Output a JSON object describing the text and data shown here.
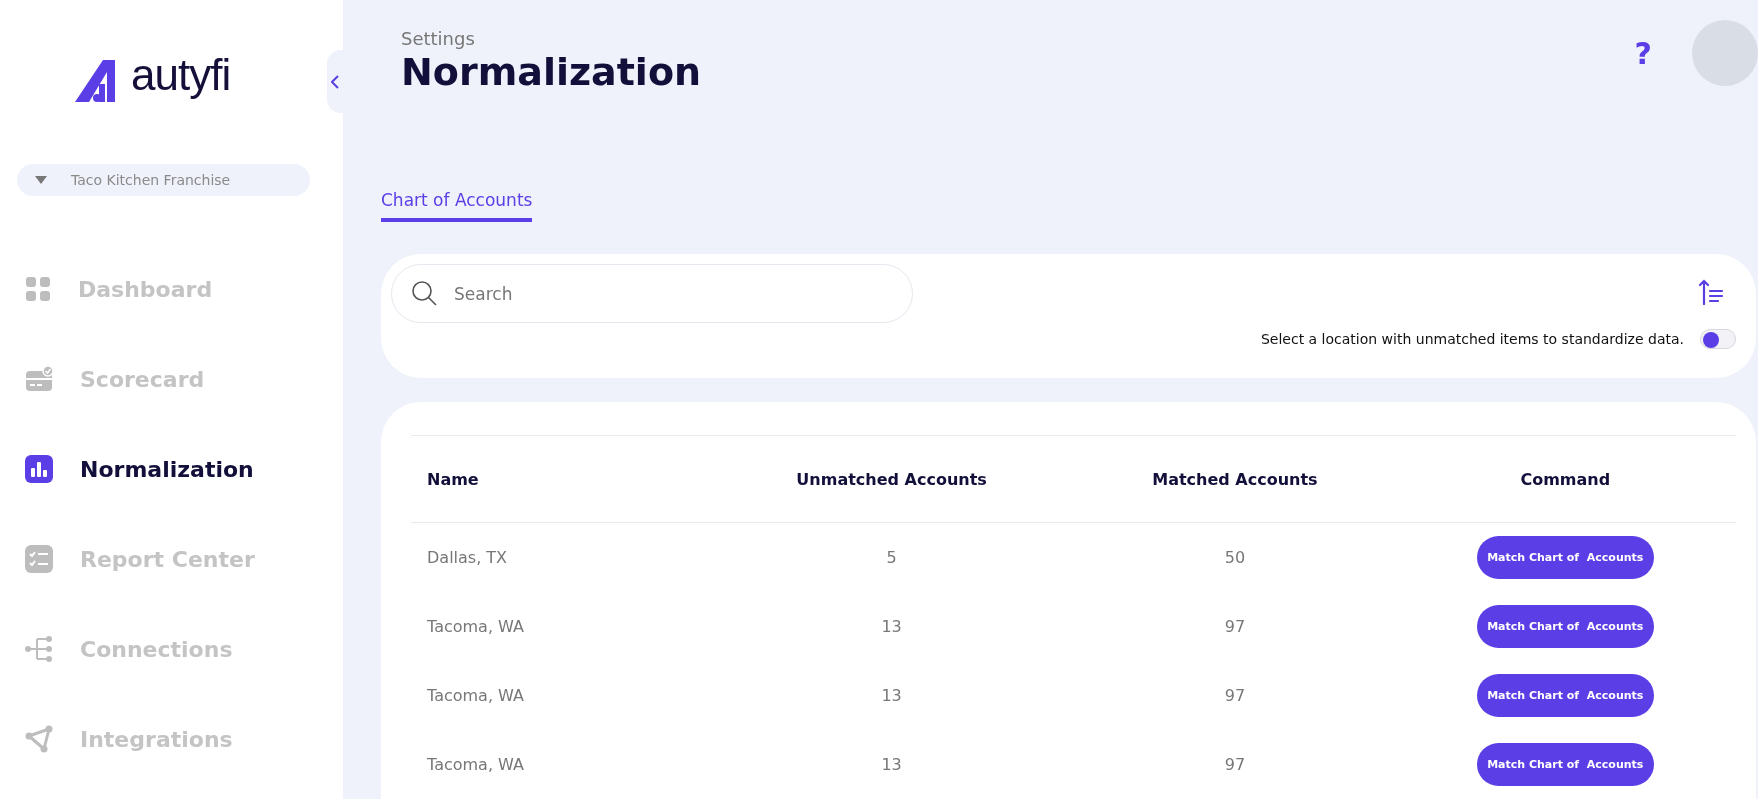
{
  "sidebar": {
    "logo": "autyfi",
    "workspace": "Taco Kitchen Franchise",
    "items": [
      {
        "kind": "dashboard",
        "label": "Dashboard",
        "selected": false
      },
      {
        "kind": "scorecard",
        "label": "Scorecard",
        "selected": false
      },
      {
        "kind": "normalization",
        "label": "Normalization",
        "selected": true
      },
      {
        "kind": "report",
        "label": "Report Center",
        "selected": false
      },
      {
        "kind": "connections",
        "label": "Connections",
        "selected": false
      },
      {
        "kind": "integrations",
        "label": "Integrations",
        "selected": false
      }
    ]
  },
  "header": {
    "breadcrumb": "Settings",
    "title": "Normalization",
    "help": "?"
  },
  "tabs": [
    {
      "label": "Chart of Accounts",
      "selected": true
    }
  ],
  "search": {
    "placeholder": "Search"
  },
  "toggle": {
    "label": "Select a location with unmatched items to standardize data.",
    "on": false
  },
  "table": {
    "columns": [
      "Name",
      "Unmatched Accounts",
      "Matched Accounts",
      "Command"
    ],
    "rows": [
      {
        "name": "Dallas, TX",
        "unmatched": "5",
        "matched": "50",
        "command": "Match Chart of  Accounts"
      },
      {
        "name": "Tacoma, WA",
        "unmatched": "13",
        "matched": "97",
        "command": "Match Chart of  Accounts"
      },
      {
        "name": "Tacoma, WA",
        "unmatched": "13",
        "matched": "97",
        "command": "Match Chart of  Accounts"
      },
      {
        "name": "Tacoma, WA",
        "unmatched": "13",
        "matched": "97",
        "command": "Match Chart of  Accounts"
      }
    ]
  }
}
